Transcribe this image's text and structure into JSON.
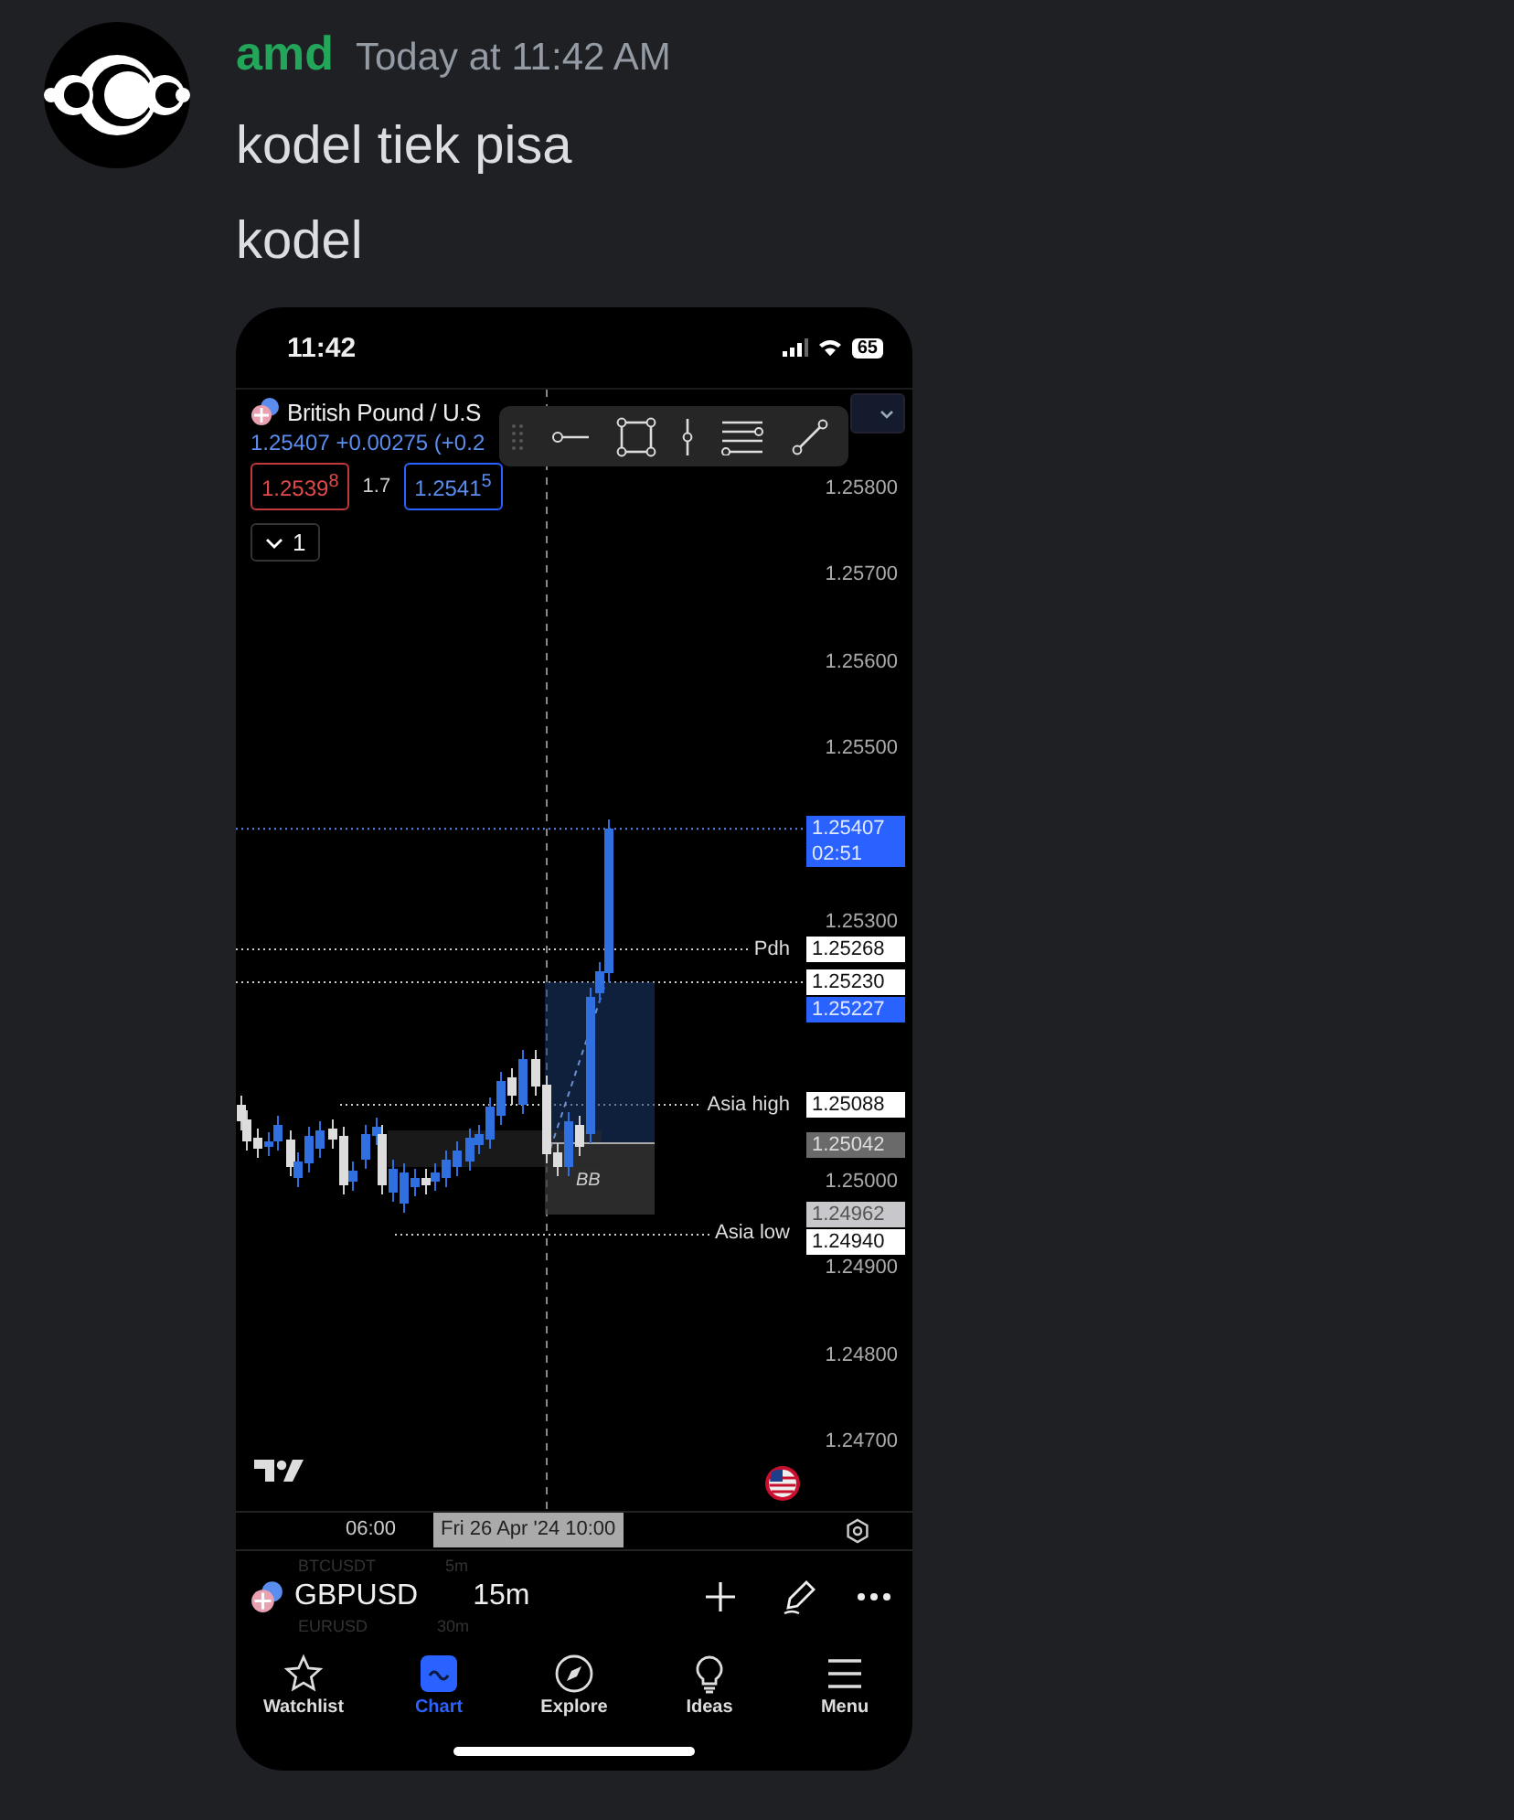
{
  "message": {
    "author": "amd",
    "timestamp": "Today at 11:42 AM",
    "lines": [
      "kodel tiek pisa",
      "kodel"
    ]
  },
  "phone": {
    "status_bar": {
      "time": "11:42",
      "battery": "65"
    },
    "chart_header": {
      "symbol": "British Pound / U.S",
      "price_change": "1.25407 +0.00275 (+0.2",
      "sell_price": "1.2539$^{8}$",
      "spread": "1.7",
      "buy_price": "1.2541$^{5}$",
      "layers_count": "1"
    },
    "price_axis": [
      "1.25800",
      "1.25700",
      "1.25600",
      "1.25500",
      "1.25300",
      "1.25000",
      "1.24900",
      "1.24800",
      "1.24700"
    ],
    "price_tags": [
      {
        "value": "1.25407",
        "sub": "02:51",
        "kind": "live"
      },
      {
        "value": "1.25268",
        "kind": "line",
        "label": "Pdh"
      },
      {
        "value": "1.25230",
        "kind": "line"
      },
      {
        "value": "1.25227",
        "kind": "live"
      },
      {
        "value": "1.25088",
        "kind": "line",
        "label": "Asia high"
      },
      {
        "value": "1.25042",
        "kind": "box"
      },
      {
        "value": "1.24962",
        "kind": "muted"
      },
      {
        "value": "1.24940",
        "kind": "line",
        "label": "Asia low"
      }
    ],
    "box_label": "BB",
    "time_axis": {
      "tick": "06:00",
      "cursor": "Fri 26 Apr '24  10:00"
    },
    "symbol_bar": {
      "above": {
        "symbol": "BTCUSDT",
        "interval": "5m"
      },
      "current": {
        "symbol": "GBPUSD",
        "interval": "15m"
      },
      "below": {
        "symbol": "EURUSD",
        "interval": "30m"
      }
    },
    "tabs": [
      {
        "label": "Watchlist",
        "kind": "star",
        "selected": false
      },
      {
        "label": "Chart",
        "kind": "chart",
        "selected": true
      },
      {
        "label": "Explore",
        "kind": "compass",
        "selected": false
      },
      {
        "label": "Ideas",
        "kind": "bulb",
        "selected": false
      },
      {
        "label": "Menu",
        "kind": "menu",
        "selected": false
      }
    ]
  }
}
